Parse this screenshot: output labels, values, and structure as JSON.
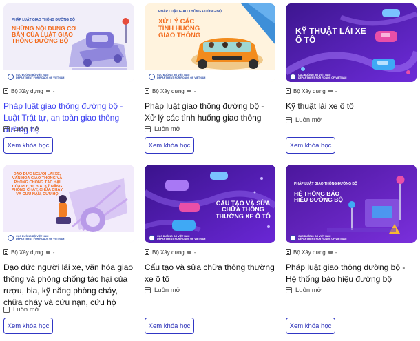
{
  "courses": [
    {
      "thumb_top": "PHÁP LUẬT GIAO THÔNG ĐƯỜNG BỘ",
      "thumb_title": "NHỮNG NỘI DUNG CƠ BẢN CỦA LUẬT GIAO THÔNG ĐƯỜNG BỘ",
      "org": "Bộ Xây dựng",
      "meta_sep": "-",
      "title": "Pháp luật giao thông đường bộ - Luật Trật tự, an toàn giao thông đường bộ",
      "status": "Luôn mở",
      "button": "Xem khóa học"
    },
    {
      "thumb_top": "PHÁP LUẬT GIAO THÔNG ĐƯỜNG BỘ",
      "thumb_title": "XỬ LÝ CÁC TÌNH HUỐNG GIAO THÔNG",
      "org": "Bộ Xây dựng",
      "meta_sep": "-",
      "title": "Pháp luật giao thông đường bộ - Xử lý các tình huống giao thông",
      "status": "Luôn mở",
      "button": "Xem khóa học"
    },
    {
      "thumb_title": "KỸ THUẬT LÁI XE Ô TÔ",
      "org": "Bộ Xây dựng",
      "meta_sep": "-",
      "title": "Kỹ thuật lái xe ô tô",
      "status": "Luôn mở",
      "button": "Xem khóa học"
    },
    {
      "thumb_title": "ĐẠO ĐỨC NGƯỜI LÁI XE, VĂN HÓA GIAO THÔNG VÀ PHÒNG CHỐNG TÁC HẠI CỦA RƯỢU, BIA, KỸ NĂNG PHÒNG CHÁY, CHỮA CHÁY VÀ CỨU NẠN, CỨU HỘ",
      "org": "Bộ Xây dựng",
      "meta_sep": "-",
      "title": "Đạo đức người lái xe, văn hóa giao thông và phòng chống tác hại của rượu, bia, kỹ năng phòng cháy, chữa cháy và cứu nạn, cứu hộ",
      "status": "Luôn mở",
      "button": "Xem khóa học"
    },
    {
      "thumb_title": "CẤU TẠO VÀ SỬA CHỮA THÔNG THƯỜNG XE Ô TÔ",
      "org": "Bộ Xây dựng",
      "meta_sep": "-",
      "title": "Cấu tạo và sửa chữa thông thường xe ô tô",
      "status": "Luôn mở",
      "button": "Xem khóa học"
    },
    {
      "thumb_top": "PHÁP LUẬT GIAO THÔNG ĐƯỜNG BỘ",
      "thumb_title": "HỆ THỐNG BÁO HIỆU ĐƯỜNG BỘ",
      "org": "Bộ Xây dựng",
      "meta_sep": "-",
      "title": "Pháp luật giao thông đường bộ - Hệ thống báo hiệu đường bộ",
      "status": "Luôn mở",
      "button": "Xem khóa học"
    }
  ],
  "logo": {
    "line1": "CỤC ĐƯỜNG BỘ VIỆT NAM",
    "line2": "DEPARTMENT FOR ROADS OF VIETNAM"
  },
  "icons": {
    "org": "building-icon",
    "status": "calendar-icon"
  },
  "colors": {
    "link": "#3a3ff1",
    "button_border": "#3036c4",
    "purple_bg": "#5b1fb8",
    "orange_title": "#f26b1d"
  }
}
